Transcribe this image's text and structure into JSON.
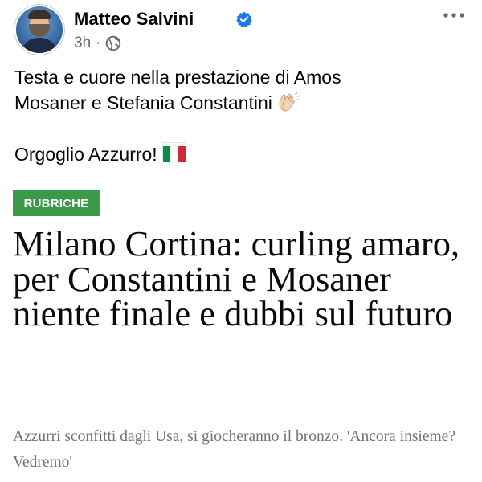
{
  "post": {
    "author": "Matteo Salvini",
    "time": "3h",
    "separator": "·",
    "text_line1": "Testa e cuore nella prestazione di Amos",
    "text_line2": "Mosaner e Stefania Constantini",
    "text_line3": "Orgoglio Azzurro!"
  },
  "article": {
    "badge": "RUBRICHE",
    "headline": "Milano Cortina: curling amaro, per Constantini e Mosaner niente finale e dubbi sul futuro",
    "subhead": "Azzurri sconfitti dagli Usa, si giocheranno il bronzo. 'Ancora insieme? Vedremo'"
  },
  "colors": {
    "badge_bg": "#3b9a49",
    "verified": "#1877f2",
    "meta_text": "#65676b",
    "subhead_text": "#737373",
    "flag_green": "#009246",
    "flag_white": "#ffffff",
    "flag_red": "#ce2b37"
  },
  "icons": [
    "avatar",
    "verified-badge-icon",
    "globe-icon",
    "more-options-icon",
    "clapping-hands-icon",
    "italy-flag-icon"
  ]
}
